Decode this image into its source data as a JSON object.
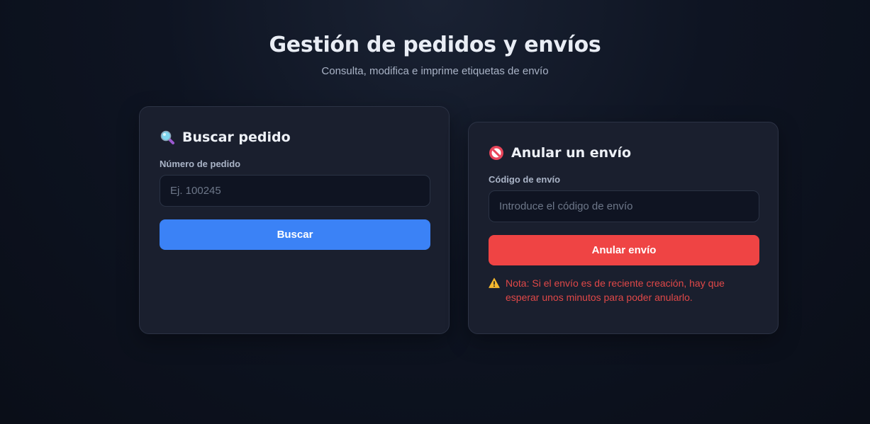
{
  "header": {
    "title": "Gestión de pedidos y envíos",
    "subtitle": "Consulta, modifica e imprime etiquetas de envío"
  },
  "search_card": {
    "icon": "magnifying-glass-icon",
    "title": "Buscar pedido",
    "field_label": "Número de pedido",
    "input_value": "",
    "input_placeholder": "Ej. 100245",
    "button_label": "Buscar"
  },
  "cancel_card": {
    "icon": "prohibited-icon",
    "title": "Anular un envío",
    "field_label": "Código de envío",
    "input_value": "",
    "input_placeholder": "Introduce el código de envío",
    "button_label": "Anular envío",
    "note_icon": "warning-icon",
    "note": "Nota: Si el envío es de reciente creación, hay que esperar unos minutos para poder anularlo."
  },
  "colors": {
    "primary": "#3b82f6",
    "danger": "#ef4444",
    "note_text": "#e04848",
    "card_background": "#1a1f2e",
    "page_background": "#0e1422"
  }
}
